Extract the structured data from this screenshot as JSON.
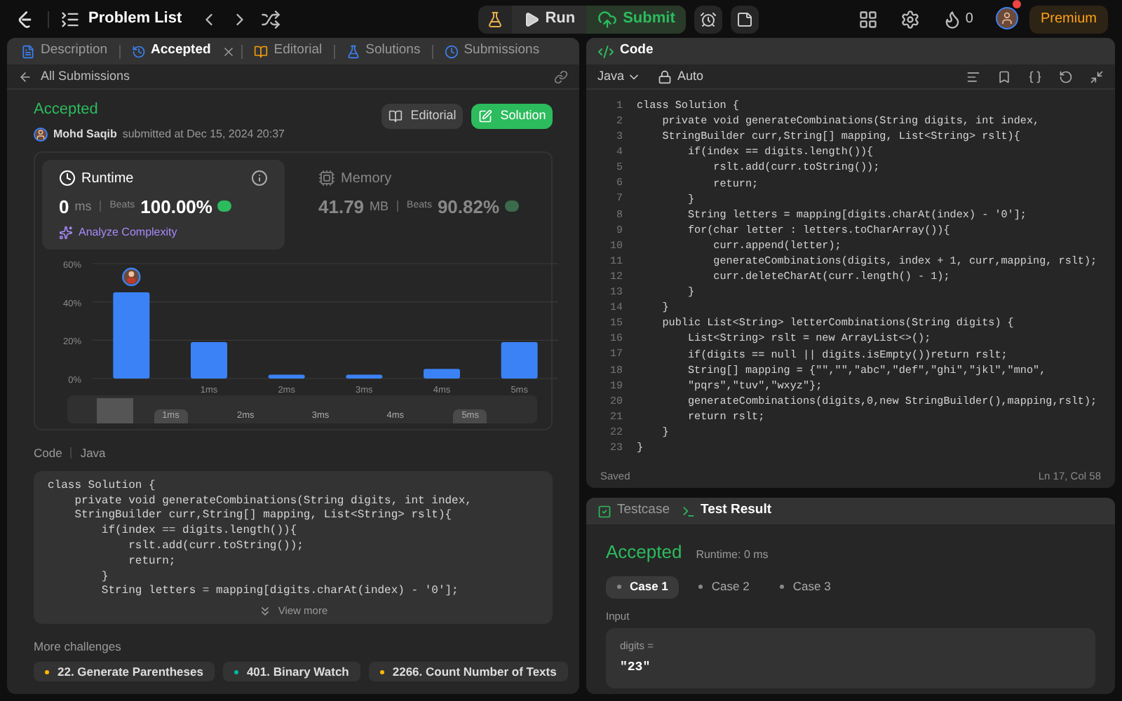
{
  "topbar": {
    "title": "Problem List",
    "run": "Run",
    "submit": "Submit",
    "coins": "0",
    "premium": "Premium"
  },
  "left_tabs": [
    {
      "label": "Description",
      "selected": false,
      "closable": false
    },
    {
      "label": "Accepted",
      "selected": true,
      "closable": true
    },
    {
      "label": "Editorial",
      "selected": false,
      "closable": false
    },
    {
      "label": "Solutions",
      "selected": false,
      "closable": false
    },
    {
      "label": "Submissions",
      "selected": false,
      "closable": false
    }
  ],
  "back_link": "All Submissions",
  "submission": {
    "status": "Accepted",
    "author": "Mohd Saqib",
    "submitted": "submitted at Dec 15, 2024 20:37",
    "buttons": [
      {
        "label": "Editorial",
        "kind": "secondary"
      },
      {
        "label": "Solution",
        "kind": "primary"
      }
    ]
  },
  "runtime": {
    "title": "Runtime",
    "value": "0",
    "unit": "ms",
    "beats_label": "Beats",
    "beats": "100.00%",
    "analyze": "Analyze Complexity",
    "selected": true
  },
  "memory": {
    "title": "Memory",
    "value": "41.79",
    "unit": "MB",
    "beats_label": "Beats",
    "beats": "90.82%",
    "selected": false
  },
  "chart_data": {
    "type": "bar",
    "categories": [
      null,
      "1ms",
      "2ms",
      "3ms",
      "4ms",
      "5ms"
    ],
    "series": [
      {
        "color": "#3b82f6",
        "values": [
          45,
          19,
          2,
          2,
          5,
          19
        ]
      }
    ],
    "ylim": [
      0,
      60
    ],
    "yticks": [
      {
        "value": 0,
        "label": "0%"
      },
      {
        "value": 20,
        "label": "20%"
      },
      {
        "value": 40,
        "label": "40%"
      },
      {
        "value": 60,
        "label": "60%"
      }
    ]
  },
  "navigator_labels": [
    "1ms",
    "2ms",
    "3ms",
    "4ms",
    "5ms"
  ],
  "code_view": {
    "label": "Code",
    "language": "Java",
    "view_more": "View more",
    "lines": [
      "class Solution {",
      "    private void generateCombinations(String digits, int index,",
      "    StringBuilder curr,String[] mapping, List<String> rslt){",
      "        if(index == digits.length()){",
      "            rslt.add(curr.toString());",
      "            return;",
      "        }",
      "        String letters = mapping[digits.charAt(index) - '0'];"
    ]
  },
  "more_challenges": {
    "title": "More challenges",
    "items": [
      {
        "label": "22. Generate Parentheses",
        "color": "#ffb800"
      },
      {
        "label": "401. Binary Watch",
        "color": "#00b8a3"
      },
      {
        "label": "2266. Count Number of Texts",
        "color": "#ffb800"
      }
    ]
  },
  "editor": {
    "title": "Code",
    "language": "Java",
    "mode": "Auto",
    "status": "Saved",
    "cursor": "Ln 17, Col 58",
    "lines": [
      {
        "number": "1",
        "text": "class Solution {"
      },
      {
        "number": "2",
        "text": "    private void generateCombinations(String digits, int index,"
      },
      {
        "number": "3",
        "text": "    StringBuilder curr,String[] mapping, List<String> rslt){"
      },
      {
        "number": "4",
        "text": "        if(index == digits.length()){"
      },
      {
        "number": "5",
        "text": "            rslt.add(curr.toString());"
      },
      {
        "number": "6",
        "text": "            return;"
      },
      {
        "number": "7",
        "text": "        }"
      },
      {
        "number": "8",
        "text": "        String letters = mapping[digits.charAt(index) - '0'];"
      },
      {
        "number": "9",
        "text": "        for(char letter : letters.toCharArray()){"
      },
      {
        "number": "10",
        "text": "            curr.append(letter);"
      },
      {
        "number": "11",
        "text": "            generateCombinations(digits, index + 1, curr,mapping, rslt);"
      },
      {
        "number": "12",
        "text": "            curr.deleteCharAt(curr.length() - 1);"
      },
      {
        "number": "13",
        "text": "        }"
      },
      {
        "number": "14",
        "text": "    }"
      },
      {
        "number": "15",
        "text": "    public List<String> letterCombinations(String digits) {"
      },
      {
        "number": "16",
        "text": "        List<String> rslt = new ArrayList<>();"
      },
      {
        "number": "17",
        "text": "        if(digits == null || digits.isEmpty())return rslt;"
      },
      {
        "number": "18",
        "text": "        String[] mapping = {\"\",\"\",\"abc\",\"def\",\"ghi\",\"jkl\",\"mno\","
      },
      {
        "number": "19",
        "text": "        \"pqrs\",\"tuv\",\"wxyz\"};"
      },
      {
        "number": "20",
        "text": "        generateCombinations(digits,0,new StringBuilder(),mapping,rslt);"
      },
      {
        "number": "21",
        "text": "        return rslt;"
      },
      {
        "number": "22",
        "text": "    }"
      },
      {
        "number": "23",
        "text": "}"
      }
    ]
  },
  "test_panel": {
    "tabs": [
      {
        "label": "Testcase",
        "selected": false
      },
      {
        "label": "Test Result",
        "selected": true
      }
    ],
    "status": "Accepted",
    "runtime": "Runtime: 0 ms",
    "cases": [
      {
        "label": "Case 1",
        "selected": true
      },
      {
        "label": "Case 2",
        "selected": false
      },
      {
        "label": "Case 3",
        "selected": false
      }
    ],
    "input_label": "Input",
    "param": "digits =",
    "value": "\"23\""
  }
}
